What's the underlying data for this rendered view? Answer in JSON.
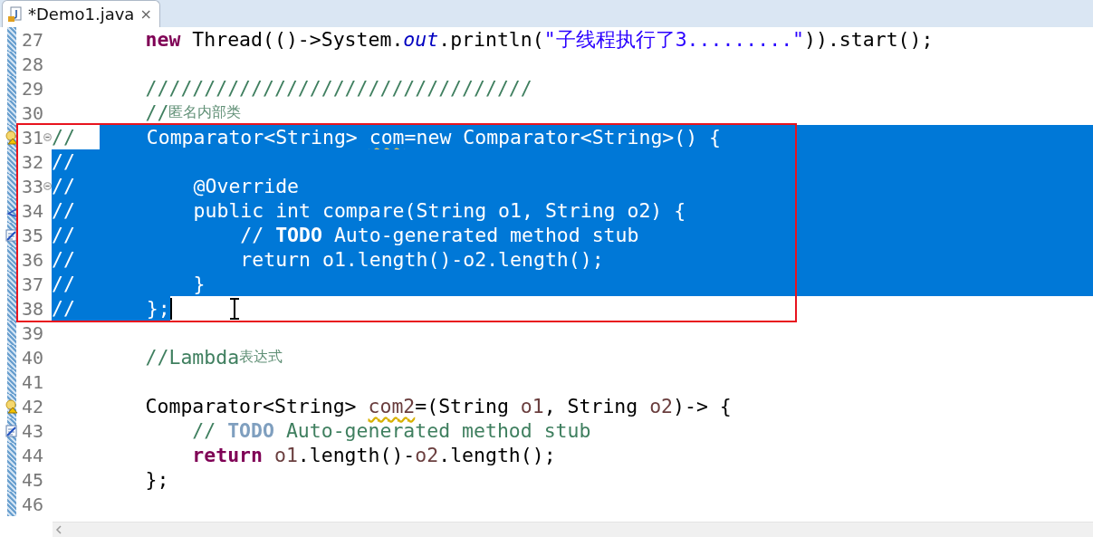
{
  "tab": {
    "title": "*Demo1.java",
    "dirty": true,
    "close": "×"
  },
  "lines": [
    {
      "number": "27",
      "fold": false,
      "selected": false,
      "caret": false,
      "mouse_pointer": false,
      "tokens": [
        {
          "kind": "keyword",
          "text": "        new"
        },
        {
          "kind": "plain",
          "text": " Thread(()->System."
        },
        {
          "kind": "field",
          "text": "out"
        },
        {
          "kind": "plain",
          "text": ".println("
        },
        {
          "kind": "string",
          "text": "\"子线程执行了3.........\""
        },
        {
          "kind": "plain",
          "text": ")).start();"
        }
      ]
    },
    {
      "number": "28",
      "fold": false,
      "selected": false,
      "caret": false,
      "mouse_pointer": false
    },
    {
      "number": "29",
      "fold": false,
      "selected": false,
      "caret": false,
      "mouse_pointer": false,
      "tokens": [
        {
          "kind": "comment",
          "text": "        /////////////////////////////////"
        }
      ]
    },
    {
      "number": "30",
      "fold": false,
      "selected": false,
      "caret": false,
      "mouse_pointer": false,
      "tokens": [
        {
          "kind": "comment",
          "text": "        //"
        },
        {
          "kind": "comment-cjk",
          "text": "匿名内部类"
        }
      ]
    },
    {
      "number": "31",
      "marker": {
        "kind": "warning"
      },
      "fold": true,
      "selected": true,
      "caret": false,
      "mouse_pointer": false,
      "prefix": "//",
      "prefix_selected": false,
      "tokens": [
        {
          "kind": "plain",
          "text": "    Comparator<String> "
        },
        {
          "kind": "unused",
          "text": "com"
        },
        {
          "kind": "plain",
          "text": "=new Comparator<String>() {"
        }
      ]
    },
    {
      "number": "32",
      "fold": false,
      "selected": true,
      "caret": false,
      "mouse_pointer": false,
      "prefix": "//",
      "prefix_selected": true
    },
    {
      "number": "33",
      "fold": true,
      "selected": true,
      "caret": false,
      "mouse_pointer": false,
      "prefix": "//",
      "prefix_selected": true,
      "tokens": [
        {
          "kind": "plain",
          "text": "        @Override"
        }
      ]
    },
    {
      "number": "34",
      "marker": {
        "kind": "override"
      },
      "fold": false,
      "selected": true,
      "caret": false,
      "mouse_pointer": false,
      "prefix": "//",
      "prefix_selected": true,
      "tokens": [
        {
          "kind": "plain",
          "text": "        public int compare(String o1, String o2) {"
        }
      ]
    },
    {
      "number": "35",
      "marker": {
        "kind": "task"
      },
      "fold": false,
      "selected": true,
      "caret": false,
      "mouse_pointer": false,
      "prefix": "//",
      "prefix_selected": true,
      "tokens": [
        {
          "kind": "plain",
          "text": "            // "
        },
        {
          "kind": "todo",
          "text": "TODO"
        },
        {
          "kind": "plain",
          "text": " Auto-generated method stub"
        }
      ]
    },
    {
      "number": "36",
      "fold": false,
      "selected": true,
      "caret": false,
      "mouse_pointer": false,
      "prefix": "//",
      "prefix_selected": true,
      "tokens": [
        {
          "kind": "plain",
          "text": "            return o1.length()-o2.length();"
        }
      ]
    },
    {
      "number": "37",
      "fold": false,
      "selected": true,
      "caret": false,
      "mouse_pointer": false,
      "prefix": "//",
      "prefix_selected": true,
      "tokens": [
        {
          "kind": "plain",
          "text": "        }"
        }
      ]
    },
    {
      "number": "38",
      "fold": false,
      "selected": true,
      "caret": true,
      "mouse_pointer": true,
      "prefix": "//",
      "prefix_selected": true,
      "tokens": [
        {
          "kind": "plain",
          "text": "    };"
        }
      ]
    },
    {
      "number": "39",
      "fold": false,
      "selected": false,
      "caret": false,
      "mouse_pointer": false
    },
    {
      "number": "40",
      "fold": false,
      "selected": false,
      "caret": false,
      "mouse_pointer": false,
      "tokens": [
        {
          "kind": "comment",
          "text": "        //Lambda"
        },
        {
          "kind": "comment-cjk",
          "text": "表达式"
        }
      ]
    },
    {
      "number": "41",
      "fold": false,
      "selected": false,
      "caret": false,
      "mouse_pointer": false
    },
    {
      "number": "42",
      "marker": {
        "kind": "warning"
      },
      "fold": false,
      "selected": false,
      "caret": false,
      "mouse_pointer": false,
      "tokens": [
        {
          "kind": "plain",
          "text": "        Comparator<String> "
        },
        {
          "kind": "unused",
          "text": "com2"
        },
        {
          "kind": "plain",
          "text": "=(String "
        },
        {
          "kind": "local",
          "text": "o1"
        },
        {
          "kind": "plain",
          "text": ", String "
        },
        {
          "kind": "local",
          "text": "o2"
        },
        {
          "kind": "plain",
          "text": ")-> {"
        }
      ]
    },
    {
      "number": "43",
      "marker": {
        "kind": "task"
      },
      "fold": false,
      "selected": false,
      "caret": false,
      "mouse_pointer": false,
      "tokens": [
        {
          "kind": "comment",
          "text": "            // "
        },
        {
          "kind": "todo",
          "text": "TODO"
        },
        {
          "kind": "comment",
          "text": " Auto-generated method stub"
        }
      ]
    },
    {
      "number": "44",
      "fold": false,
      "selected": false,
      "caret": false,
      "mouse_pointer": false,
      "tokens": [
        {
          "kind": "keyword",
          "text": "            return"
        },
        {
          "kind": "local",
          "text": " o1"
        },
        {
          "kind": "plain",
          "text": ".length()-"
        },
        {
          "kind": "local",
          "text": "o2"
        },
        {
          "kind": "plain",
          "text": ".length();"
        }
      ]
    },
    {
      "number": "45",
      "fold": false,
      "selected": false,
      "caret": false,
      "mouse_pointer": false,
      "tokens": [
        {
          "kind": "plain",
          "text": "        };"
        }
      ]
    },
    {
      "number": "46",
      "fold": false,
      "selected": false,
      "caret": false,
      "mouse_pointer": false
    }
  ]
}
